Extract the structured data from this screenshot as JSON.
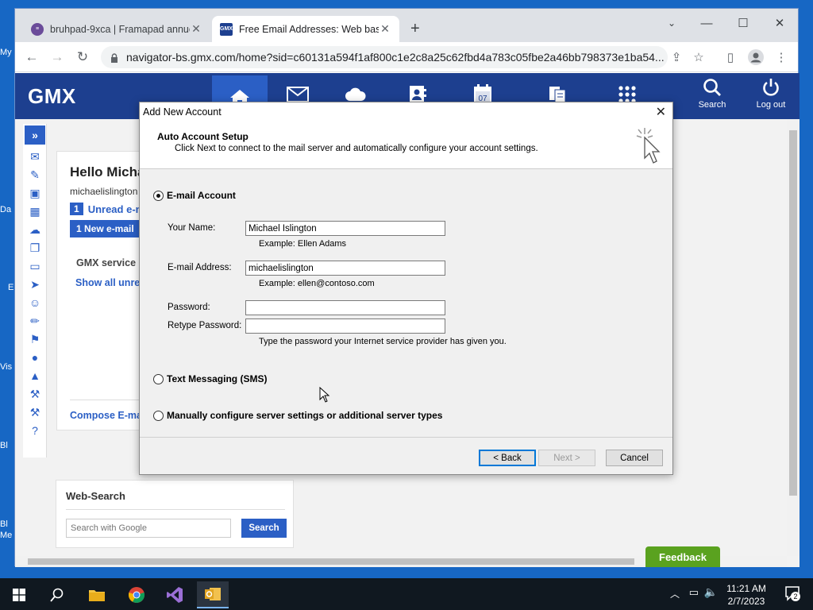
{
  "desktop": {
    "labels": [
      "My",
      "Da",
      "E",
      "Vis",
      "Bl",
      "Bl",
      "Me"
    ]
  },
  "browser": {
    "tabs": [
      {
        "title": "bruhpad-9xca | Framapad annuel",
        "favicon": "framapad-icon"
      },
      {
        "title": "Free Email Addresses: Web base",
        "favicon": "gmx-icon",
        "favicon_text": "GMX"
      }
    ],
    "url": "navigator-bs.gmx.com/home?sid=c60131a594f1af800c1e2c8a25c62fbd4a783c05fbe2a46bb798373e1ba54..."
  },
  "gmx": {
    "logo": "GMX",
    "nav": [
      {
        "icon": "home-icon"
      },
      {
        "icon": "mail-icon"
      },
      {
        "icon": "cloud-icon"
      },
      {
        "icon": "contacts-icon"
      },
      {
        "icon": "calendar-icon",
        "text": "07"
      },
      {
        "icon": "documents-icon"
      },
      {
        "icon": "apps-grid-icon"
      }
    ],
    "search_label": "Search",
    "logout_label": "Log out",
    "rail_expand": "»",
    "welcome": {
      "hello": "Hello Micha",
      "user": "michaelislington",
      "unread_count": "1",
      "unread_label": "Unread e-m",
      "new_email": "1 New e-mail",
      "gmx_service": "GMX service",
      "show_all": "Show all unre",
      "compose": "Compose E-ma"
    },
    "websearch": {
      "title": "Web-Search",
      "placeholder": "Search with Google",
      "button": "Search"
    },
    "feedback": "Feedback"
  },
  "dialog": {
    "title": "Add New Account",
    "header_title": "Auto Account Setup",
    "header_subtitle": "Click Next to connect to the mail server and automatically configure your account settings.",
    "option_email": "E-mail Account",
    "your_name_label": "Your Name:",
    "your_name_value": "Michael Islington",
    "your_name_example": "Example: Ellen Adams",
    "email_label": "E-mail Address:",
    "email_value": "michaelislington",
    "email_example": "Example: ellen@contoso.com",
    "password_label": "Password:",
    "password_value": "",
    "retype_label": "Retype Password:",
    "retype_value": "",
    "password_hint": "Type the password your Internet service provider has given you.",
    "option_sms": "Text Messaging (SMS)",
    "option_manual": "Manually configure server settings or additional server types",
    "back_button": "< Back",
    "next_button": "Next >",
    "cancel_button": "Cancel"
  },
  "taskbar": {
    "apps": [
      "file-explorer-icon",
      "chrome-icon",
      "visual-studio-icon",
      "outlook-icon"
    ],
    "time": "11:21 AM",
    "date": "2/7/2023",
    "notification_count": "2"
  }
}
